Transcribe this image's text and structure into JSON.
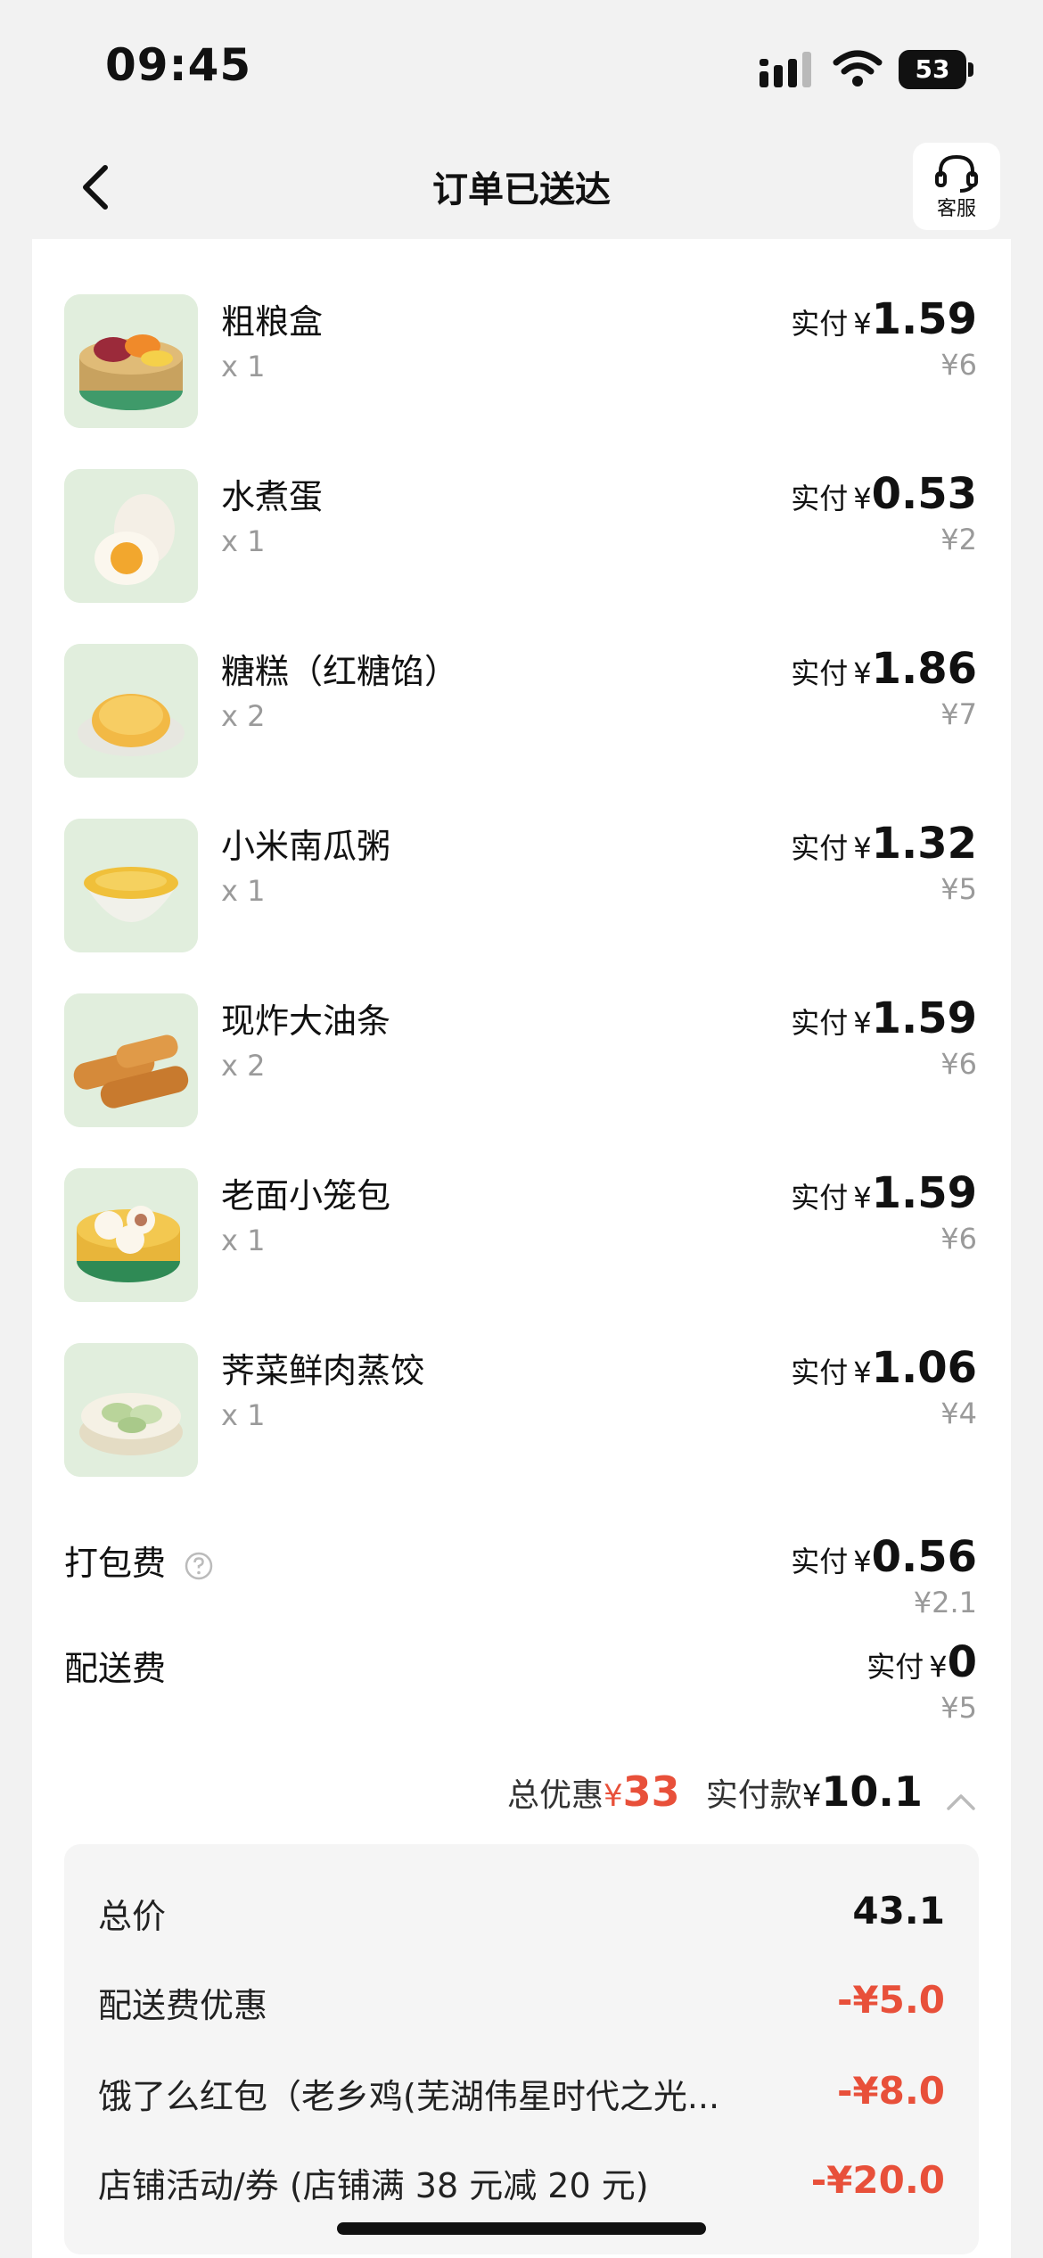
{
  "status": {
    "time": "09:45",
    "battery": "53"
  },
  "nav": {
    "title": "订单已送达",
    "service_label": "客服"
  },
  "items": [
    {
      "name": "粗粮盒",
      "qty": "x 1",
      "pay_label": "实付",
      "currency": "¥",
      "pay_amount": "1.59",
      "original": "¥6",
      "thumb": "grains-box-icon"
    },
    {
      "name": "水煮蛋",
      "qty": "x 1",
      "pay_label": "实付",
      "currency": "¥",
      "pay_amount": "0.53",
      "original": "¥2",
      "thumb": "boiled-egg-icon"
    },
    {
      "name": "糖糕（红糖馅）",
      "qty": "x 2",
      "pay_label": "实付",
      "currency": "¥",
      "pay_amount": "1.86",
      "original": "¥7",
      "thumb": "sugar-cake-icon"
    },
    {
      "name": "小米南瓜粥",
      "qty": "x 1",
      "pay_label": "实付",
      "currency": "¥",
      "pay_amount": "1.32",
      "original": "¥5",
      "thumb": "porridge-icon"
    },
    {
      "name": "现炸大油条",
      "qty": "x 2",
      "pay_label": "实付",
      "currency": "¥",
      "pay_amount": "1.59",
      "original": "¥6",
      "thumb": "fried-dough-icon"
    },
    {
      "name": "老面小笼包",
      "qty": "x 1",
      "pay_label": "实付",
      "currency": "¥",
      "pay_amount": "1.59",
      "original": "¥6",
      "thumb": "buns-icon"
    },
    {
      "name": "荠菜鲜肉蒸饺",
      "qty": "x 1",
      "pay_label": "实付",
      "currency": "¥",
      "pay_amount": "1.06",
      "original": "¥4",
      "thumb": "dumplings-icon"
    }
  ],
  "fees": [
    {
      "name": "打包费",
      "pay_label": "实付",
      "currency": "¥",
      "pay_amount": "0.56",
      "original": "¥2.1"
    },
    {
      "name": "配送费",
      "pay_label": "实付",
      "currency": "¥",
      "pay_amount": "0",
      "original": "¥5"
    }
  ],
  "summary": {
    "discount_label": "总优惠",
    "discount_currency": "¥",
    "discount_amount": "33",
    "paid_label": "实付款",
    "paid_currency": "¥",
    "paid_amount": "10.1"
  },
  "breakdown": [
    {
      "label": "总价",
      "value": "43.1",
      "highlight": false
    },
    {
      "label": "配送费优惠",
      "value": "-¥5.0",
      "highlight": true
    },
    {
      "label": "饿了么红包（老乡鸡(芜湖伟星时代之光...",
      "value": "-¥8.0",
      "highlight": true
    },
    {
      "label": "店铺活动/券 (店铺满 38 元减 20 元)",
      "value": "-¥20.0",
      "highlight": true
    }
  ],
  "colors": {
    "accent_red": "#e8503a",
    "background": "#f2f2f2",
    "card": "#ffffff"
  }
}
